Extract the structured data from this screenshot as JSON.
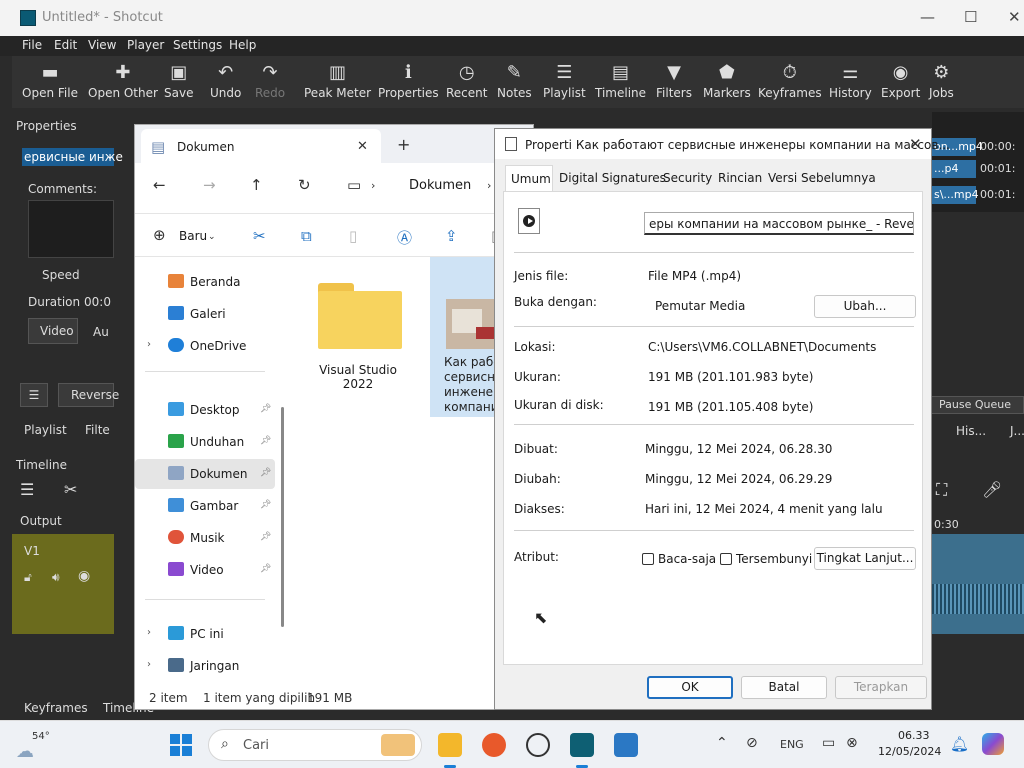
{
  "shotcut": {
    "title": "Untitled* - Shotcut",
    "menu": [
      "File",
      "Edit",
      "View",
      "Player",
      "Settings",
      "Help"
    ],
    "toolbar": [
      "Open File",
      "Open Other",
      "Save",
      "Undo",
      "Redo",
      "Peak Meter",
      "Properties",
      "Recent",
      "Notes",
      "Playlist",
      "Timeline",
      "Filters",
      "Markers",
      "Keyframes",
      "History",
      "Export",
      "Jobs"
    ],
    "properties_label": "Properties",
    "clip_title": "ервисные инже",
    "comments": "Comments:",
    "speed": "Speed",
    "duration": "Duration",
    "duration_value": "00:0",
    "tab_video": "Video",
    "tab_audio": "Au",
    "reverse": "Reverse",
    "playlist": "Playlist",
    "filters": "Filte",
    "timeline": "Timeline",
    "output": "Output",
    "track": "V1",
    "keyframes": "Keyframes",
    "timeline_tab": "Timeline",
    "right": {
      "jobs": [
        {
          "name": "on...mp4",
          "time": "00:00:"
        },
        {
          "name": "...p4",
          "time": "00:01:"
        },
        {
          "name": "s\\...mp4",
          "time": "00:01:"
        }
      ],
      "pause_queue": "Pause Queue",
      "his": "His...",
      "j": "J...",
      "ruler": "0:30"
    }
  },
  "explorer": {
    "tab_title": "Dokumen",
    "path": "Dokumen",
    "new_label": "Baru",
    "sidebar": [
      {
        "label": "Beranda",
        "color": "#e8833a",
        "pin": false
      },
      {
        "label": "Galeri",
        "color": "#2b7fd4",
        "pin": false
      },
      {
        "label": "OneDrive",
        "color": "#1f7fd8",
        "pin": false,
        "chevron": true
      },
      {
        "label": "Desktop",
        "color": "#3a9be0",
        "pin": true
      },
      {
        "label": "Unduhan",
        "color": "#2aa34a",
        "pin": true
      },
      {
        "label": "Dokumen",
        "color": "#8fa5c4",
        "pin": true,
        "selected": true
      },
      {
        "label": "Gambar",
        "color": "#3f8fd8",
        "pin": true
      },
      {
        "label": "Musik",
        "color": "#e0543a",
        "pin": true
      },
      {
        "label": "Video",
        "color": "#8a4ad0",
        "pin": true
      },
      {
        "label": "PC ini",
        "color": "#2b9ad8",
        "pin": false,
        "chevron": true
      },
      {
        "label": "Jaringan",
        "color": "#4a6a8a",
        "pin": false,
        "chevron": true
      }
    ],
    "files": [
      {
        "name": "Visual Studio 2022",
        "kind": "folder"
      },
      {
        "name": "Как работ сервисн инжене компани",
        "kind": "video"
      }
    ],
    "status": {
      "count": "2 item",
      "selected": "1 item yang dipilih",
      "size": "191 MB"
    }
  },
  "props": {
    "title": "Properti Как работают сервисные инженеры компании на массов...",
    "tabs": [
      "Umum",
      "Digital Signatures",
      "Security",
      "Rincian",
      "Versi Sebelumnya"
    ],
    "filename": "еры компании на массовом рынке_ - Reversed",
    "rows": {
      "jenis_label": "Jenis file:",
      "jenis_value": "File MP4 (.mp4)",
      "buka_label": "Buka dengan:",
      "buka_value": "Pemutar Media",
      "ubah": "Ubah...",
      "lokasi_label": "Lokasi:",
      "lokasi_value": "C:\\Users\\VM6.COLLABNET\\Documents",
      "ukuran_label": "Ukuran:",
      "ukuran_value": "191 MB (201.101.983 byte)",
      "disk_label": "Ukuran di disk:",
      "disk_value": "191 MB (201.105.408 byte)",
      "dibuat_label": "Dibuat:",
      "dibuat_value": "Minggu, 12 Mei 2024, 06.28.30",
      "diubah_label": "Diubah:",
      "diubah_value": "Minggu, 12 Mei 2024, 06.29.29",
      "diakses_label": "Diakses:",
      "diakses_value": "Hari ini, 12 Mei 2024, 4 menit yang lalu",
      "atribut_label": "Atribut:",
      "baca": "Baca-saja",
      "tersembunyi": "Tersembunyi",
      "lanjut": "Tingkat Lanjut..."
    },
    "ok": "OK",
    "batal": "Batal",
    "terapkan": "Terapkan"
  },
  "taskbar": {
    "weather": "54°",
    "search": "Cari",
    "lang": "ENG",
    "time": "06.33",
    "date": "12/05/2024"
  }
}
